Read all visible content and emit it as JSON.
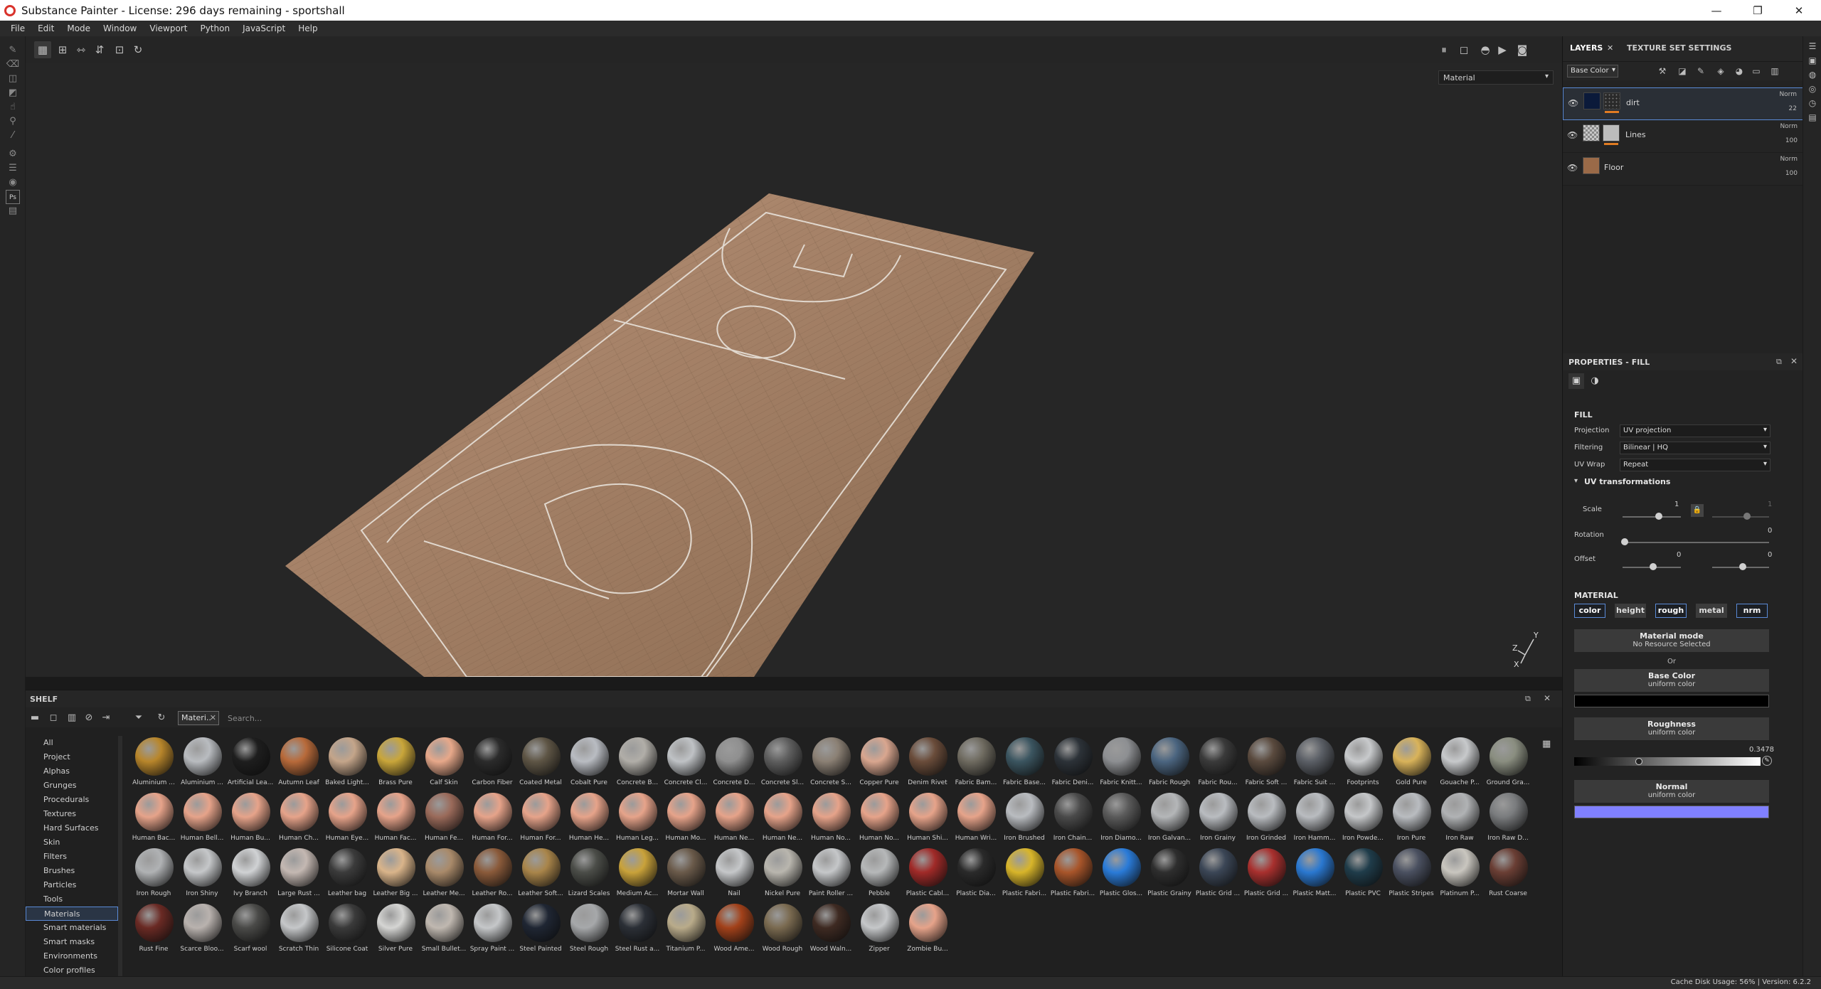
{
  "window": {
    "title": "Substance Painter - License: 296 days remaining - sportshall",
    "controls": [
      "—",
      "❐",
      "✕"
    ]
  },
  "menu": [
    "File",
    "Edit",
    "Mode",
    "Window",
    "Viewport",
    "Python",
    "JavaScript",
    "Help"
  ],
  "viewport": {
    "channel": "Material",
    "axis_labels": [
      "Y",
      "Z",
      "X"
    ]
  },
  "shelf": {
    "title": "SHELF",
    "filter_chip": "Materi..",
    "search_placeholder": "Search...",
    "categories": [
      "All",
      "Project",
      "Alphas",
      "Grunges",
      "Procedurals",
      "Textures",
      "Hard Surfaces",
      "Skin",
      "Filters",
      "Brushes",
      "Particles",
      "Tools",
      "Materials",
      "Smart materials",
      "Smart masks",
      "Environments",
      "Color profiles"
    ],
    "selected_category": "Materials",
    "materials": [
      {
        "label": "Aluminium ...",
        "color": "#b8862b"
      },
      {
        "label": "Aluminium ...",
        "color": "#b9bcc0"
      },
      {
        "label": "Artificial Lea...",
        "color": "#1e1e1e"
      },
      {
        "label": "Autumn Leaf",
        "color": "#b86a3a"
      },
      {
        "label": "Baked Light...",
        "color": "#c4a58a"
      },
      {
        "label": "Brass Pure",
        "color": "#c9a63a"
      },
      {
        "label": "Calf Skin",
        "color": "#e7a88a"
      },
      {
        "label": "Carbon Fiber",
        "color": "#2b2b2b"
      },
      {
        "label": "Coated Metal",
        "color": "#5e5545"
      },
      {
        "label": "Cobalt Pure",
        "color": "#b9bcc2"
      },
      {
        "label": "Concrete B...",
        "color": "#b1aea8"
      },
      {
        "label": "Concrete Cl...",
        "color": "#bfc2c5"
      },
      {
        "label": "Concrete D...",
        "color": "#8f8f8f"
      },
      {
        "label": "Concrete Sl...",
        "color": "#5e5e5e"
      },
      {
        "label": "Concrete S...",
        "color": "#8b8074"
      },
      {
        "label": "Copper Pure",
        "color": "#d9a68f"
      },
      {
        "label": "Denim Rivet",
        "color": "#6a4c3a"
      },
      {
        "label": "Fabric Bam...",
        "color": "#6f6b60"
      },
      {
        "label": "Fabric Base...",
        "color": "#3b5560"
      },
      {
        "label": "Fabric Deni...",
        "color": "#2c3238"
      },
      {
        "label": "Fabric Knitt...",
        "color": "#8d8f92"
      },
      {
        "label": "Fabric Rough",
        "color": "#4b6580"
      },
      {
        "label": "Fabric Rou...",
        "color": "#3a3a3a"
      },
      {
        "label": "Fabric Soft ...",
        "color": "#5a4a3e"
      },
      {
        "label": "Fabric Suit ...",
        "color": "#5b5f66"
      },
      {
        "label": "Footprints",
        "color": "#c8cacc"
      },
      {
        "label": "Gold Pure",
        "color": "#d9b35a"
      },
      {
        "label": "Gouache P...",
        "color": "#c7c9cb"
      },
      {
        "label": "Ground Gra...",
        "color": "#8a8e80"
      },
      {
        "label": "Human Bac...",
        "color": "#e6a38a"
      },
      {
        "label": "Human Bell...",
        "color": "#e6a38a"
      },
      {
        "label": "Human Bu...",
        "color": "#e6a38a"
      },
      {
        "label": "Human Ch...",
        "color": "#e6a38a"
      },
      {
        "label": "Human Eye...",
        "color": "#e6a38a"
      },
      {
        "label": "Human Fac...",
        "color": "#e6a38a"
      },
      {
        "label": "Human Fe...",
        "color": "#9a6a5a"
      },
      {
        "label": "Human For...",
        "color": "#e6a38a"
      },
      {
        "label": "Human For...",
        "color": "#e6a38a"
      },
      {
        "label": "Human He...",
        "color": "#e6a38a"
      },
      {
        "label": "Human Leg...",
        "color": "#e6a38a"
      },
      {
        "label": "Human Mo...",
        "color": "#e6a38a"
      },
      {
        "label": "Human Ne...",
        "color": "#e6a38a"
      },
      {
        "label": "Human Ne...",
        "color": "#e6a38a"
      },
      {
        "label": "Human No...",
        "color": "#e6a38a"
      },
      {
        "label": "Human No...",
        "color": "#e6a38a"
      },
      {
        "label": "Human Shi...",
        "color": "#e6a38a"
      },
      {
        "label": "Human Wri...",
        "color": "#e6a38a"
      },
      {
        "label": "Iron Brushed",
        "color": "#b9bcc0"
      },
      {
        "label": "Iron Chain...",
        "color": "#4a4a4a"
      },
      {
        "label": "Iron Diamo...",
        "color": "#5a5a5a"
      },
      {
        "label": "Iron Galvan...",
        "color": "#b4b6b8"
      },
      {
        "label": "Iron Grainy",
        "color": "#b9bcc0"
      },
      {
        "label": "Iron Grinded",
        "color": "#b9bcc0"
      },
      {
        "label": "Iron Hamm...",
        "color": "#b9bcc0"
      },
      {
        "label": "Iron Powde...",
        "color": "#c5c7c9"
      },
      {
        "label": "Iron Pure",
        "color": "#b9bcc0"
      },
      {
        "label": "Iron Raw",
        "color": "#b0b2b4"
      },
      {
        "label": "Iron Raw D...",
        "color": "#7a7c7e"
      },
      {
        "label": "Iron Rough",
        "color": "#b0b2b4"
      },
      {
        "label": "Iron Shiny",
        "color": "#c5c7c9"
      },
      {
        "label": "Ivy Branch",
        "color": "#d0d2d4"
      },
      {
        "label": "Large Rust ...",
        "color": "#c4b8b2"
      },
      {
        "label": "Leather bag",
        "color": "#3b3b3b"
      },
      {
        "label": "Leather Big ...",
        "color": "#d9b48a"
      },
      {
        "label": "Leather Me...",
        "color": "#a98a6a"
      },
      {
        "label": "Leather Ro...",
        "color": "#8a5a3a"
      },
      {
        "label": "Leather Soft...",
        "color": "#a9854a"
      },
      {
        "label": "Lizard Scales",
        "color": "#4b4d48"
      },
      {
        "label": "Medium Ac...",
        "color": "#c9a23a"
      },
      {
        "label": "Mortar Wall",
        "color": "#6a5a4a"
      },
      {
        "label": "Nail",
        "color": "#c5c7c9"
      },
      {
        "label": "Nickel Pure",
        "color": "#b9b6ae"
      },
      {
        "label": "Paint Roller ...",
        "color": "#c5c7c9"
      },
      {
        "label": "Pebble",
        "color": "#b6b8b9"
      },
      {
        "label": "Plastic Cabl...",
        "color": "#a02a28"
      },
      {
        "label": "Plastic Dia...",
        "color": "#2a2a2a"
      },
      {
        "label": "Plastic Fabri...",
        "color": "#d8b52a"
      },
      {
        "label": "Plastic Fabri...",
        "color": "#a8552a"
      },
      {
        "label": "Plastic Glos...",
        "color": "#2a7bd8"
      },
      {
        "label": "Plastic Grainy",
        "color": "#2e2e2e"
      },
      {
        "label": "Plastic Grid ...",
        "color": "#3b4656"
      },
      {
        "label": "Plastic Grid ...",
        "color": "#a8302e"
      },
      {
        "label": "Plastic Matt...",
        "color": "#2a78d0"
      },
      {
        "label": "Plastic PVC",
        "color": "#1f3c4a"
      },
      {
        "label": "Plastic Stripes",
        "color": "#4a5060"
      },
      {
        "label": "Platinum P...",
        "color": "#c9c6bf"
      },
      {
        "label": "Rust Coarse",
        "color": "#6a3e34"
      },
      {
        "label": "Rust Fine",
        "color": "#6a2a24"
      },
      {
        "label": "Scarce Bloo...",
        "color": "#b9b2ae"
      },
      {
        "label": "Scarf wool",
        "color": "#4a4a48"
      },
      {
        "label": "Scratch Thin",
        "color": "#c5c7c9"
      },
      {
        "label": "Silicone Coat",
        "color": "#3a3a3a"
      },
      {
        "label": "Silver Pure",
        "color": "#d5d5d3"
      },
      {
        "label": "Small Bullet...",
        "color": "#c0b8b0"
      },
      {
        "label": "Spray Paint ...",
        "color": "#c5c7c9"
      },
      {
        "label": "Steel Painted",
        "color": "#1f2633"
      },
      {
        "label": "Steel Rough",
        "color": "#a6a8aa"
      },
      {
        "label": "Steel Rust a...",
        "color": "#2b2f36"
      },
      {
        "label": "Titanium P...",
        "color": "#b9ab8a"
      },
      {
        "label": "Wood Ame...",
        "color": "#a2411a"
      },
      {
        "label": "Wood Rough",
        "color": "#7a6a50"
      },
      {
        "label": "Wood Waln...",
        "color": "#3e2a22"
      },
      {
        "label": "Zipper",
        "color": "#c5c7c9"
      },
      {
        "label": "Zombie Bu...",
        "color": "#e6a38a"
      }
    ]
  },
  "layers_panel": {
    "tabs": [
      "LAYERS",
      "TEXTURE SET SETTINGS"
    ],
    "channel": "Base Color",
    "layers": [
      {
        "name": "dirt",
        "blend": "Norm",
        "opacity": "22",
        "selected": true
      },
      {
        "name": "Lines",
        "blend": "Norm",
        "opacity": "100",
        "selected": false
      },
      {
        "name": "Floor",
        "blend": "Norm",
        "opacity": "100",
        "selected": false
      }
    ]
  },
  "properties": {
    "title": "PROPERTIES - FILL",
    "fill_title": "FILL",
    "projection_label": "Projection",
    "projection_value": "UV projection",
    "filtering_label": "Filtering",
    "filtering_value": "Bilinear | HQ",
    "uvwrap_label": "UV Wrap",
    "uvwrap_value": "Repeat",
    "uv_transform_title": "UV transformations",
    "scale_label": "Scale",
    "scale_value": "1",
    "scale_value2": "1",
    "rotation_label": "Rotation",
    "rotation_value": "0",
    "offset_label": "Offset",
    "offset_value_u": "0",
    "offset_value_v": "0",
    "material_title": "MATERIAL",
    "channels": [
      {
        "label": "color",
        "on": true
      },
      {
        "label": "height",
        "on": false
      },
      {
        "label": "rough",
        "on": true
      },
      {
        "label": "metal",
        "on": false
      },
      {
        "label": "nrm",
        "on": true
      }
    ],
    "material_mode_title": "Material mode",
    "material_mode_sub": "No Resource Selected",
    "or_text": "Or",
    "base_color_title": "Base Color",
    "base_color_sub": "uniform color",
    "base_color_value": "#000000",
    "roughness_title": "Roughness",
    "roughness_sub": "uniform color",
    "roughness_value": "0.3478",
    "normal_title": "Normal",
    "normal_sub": "uniform color",
    "normal_color": "#8080ff"
  },
  "status": {
    "text": "Cache Disk Usage:    56% | Version: 6.2.2"
  }
}
